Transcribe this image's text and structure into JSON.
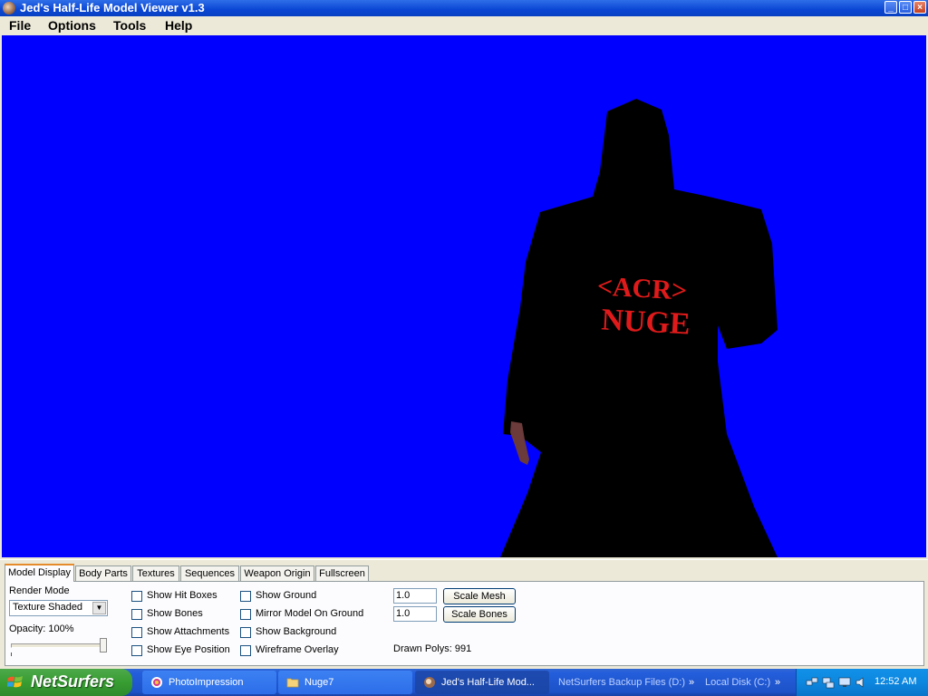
{
  "window": {
    "title": "Jed's Half-Life Model Viewer v1.3"
  },
  "menu": [
    "File",
    "Options",
    "Tools",
    "Help"
  ],
  "model_texture": {
    "line1": "<ACR>",
    "line2": "NUGE",
    "text_color": "#e01a1a"
  },
  "viewport": {
    "background": "#0000fe"
  },
  "tabs": [
    "Model Display",
    "Body Parts",
    "Textures",
    "Sequences",
    "Weapon Origin",
    "Fullscreen"
  ],
  "model_display": {
    "render_mode_label": "Render Mode",
    "render_mode_value": "Texture Shaded",
    "opacity_label": "Opacity: 100%",
    "opacity_level": 1.0,
    "checkboxes_col1": [
      "Show Hit Boxes",
      "Show Bones",
      "Show Attachments",
      "Show Eye Position"
    ],
    "checkboxes_col2": [
      "Show Ground",
      "Mirror Model On Ground",
      "Show Background",
      "Wireframe Overlay"
    ],
    "scale_mesh_value": "1.0",
    "scale_bones_value": "1.0",
    "scale_mesh_button": "Scale Mesh",
    "scale_bones_button": "Scale Bones",
    "drawn_polys": "Drawn Polys: 991"
  },
  "taskbar": {
    "start_label": "NetSurfers",
    "tasks": [
      "PhotoImpression",
      "Nuge7",
      "Jed's Half-Life Mod..."
    ],
    "quick_links": [
      "NetSurfers Backup Files (D:)",
      "Local Disk (C:)"
    ],
    "quick_chevron": "»",
    "clock": "12:52 AM"
  }
}
